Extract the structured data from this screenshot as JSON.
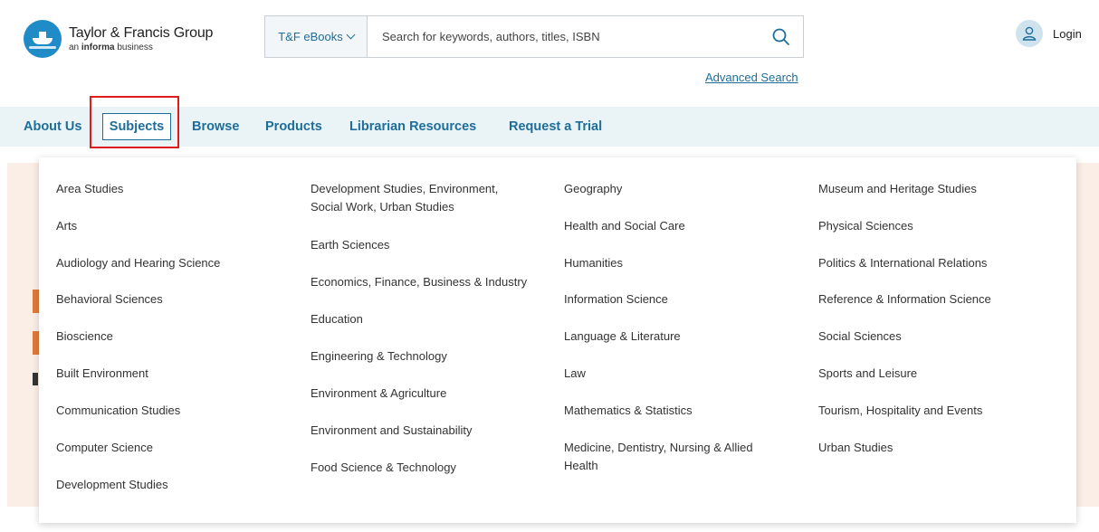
{
  "brand": {
    "name": "Taylor & Francis Group",
    "tagline_prefix": "an",
    "tagline_bold": "informa",
    "tagline_suffix": "business"
  },
  "search": {
    "scope": "T&F eBooks",
    "placeholder": "Search for keywords, authors, titles, ISBN",
    "advanced_label": "Advanced Search"
  },
  "login": {
    "label": "Login"
  },
  "nav": {
    "about": "About Us",
    "subjects": "Subjects",
    "browse": "Browse",
    "products": "Products",
    "librarian": "Librarian Resources",
    "trial": "Request a Trial"
  },
  "subjects": {
    "col1": [
      "Area Studies",
      "Arts",
      "Audiology and Hearing Science",
      "Behavioral Sciences",
      "Bioscience",
      "Built Environment",
      "Communication Studies",
      "Computer Science",
      "Development Studies"
    ],
    "col2": [
      "Development Studies, Environment, Social Work, Urban Studies",
      "Earth Sciences",
      "Economics, Finance, Business & Industry",
      "Education",
      "Engineering & Technology",
      "Environment & Agriculture",
      "Environment and Sustainability",
      "Food Science & Technology"
    ],
    "col3": [
      "Geography",
      "Health and Social Care",
      "Humanities",
      "Information Science",
      "Language & Literature",
      "Law",
      "Mathematics & Statistics",
      "Medicine, Dentistry, Nursing & Allied Health"
    ],
    "col4": [
      "Museum and Heritage Studies",
      "Physical Sciences",
      "Politics & International Relations",
      "Reference & Information Science",
      "Social Sciences",
      "Sports and Leisure",
      "Tourism, Hospitality and Events",
      "Urban Studies"
    ]
  },
  "colors": {
    "brand_blue": "#1f8bc7",
    "link_blue": "#1d6e9a",
    "nav_bg": "#eaf3f6",
    "highlight_red": "#e01b1b"
  }
}
